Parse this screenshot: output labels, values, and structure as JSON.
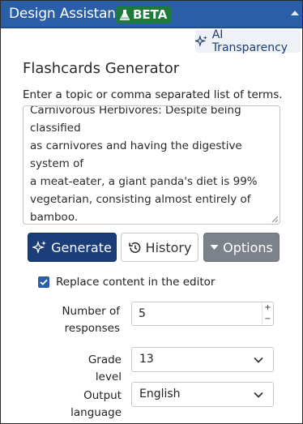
{
  "header": {
    "app_title": "Design Assistant",
    "badge_label": "BETA",
    "badge_icon": "flask-icon"
  },
  "toolbar": {
    "transparency_label": "AI Transparency",
    "transparency_icon": "sparkle-icon"
  },
  "form": {
    "section_title": "Flashcards Generator",
    "instructions": "Enter a topic or comma separated list of terms.",
    "topic_text": "Carnivorous Herbivores: Despite being classified\nas carnivores and having the digestive system of\na meat-eater, a giant panda's diet is 99%\nvegetarian, consisting almost entirely of bamboo.\n\nA Built-in Bamboo Grasp: To help them hold and\nstrip bamboo stalks, pandas have evolved a"
  },
  "actions": {
    "generate_label": "Generate",
    "history_label": "History",
    "options_label": "Options"
  },
  "options": {
    "replace_label": "Replace content in the editor",
    "replace_checked": true,
    "responses_label_line1": "Number of",
    "responses_label_line2": "responses",
    "responses_value": "5",
    "stepper_up": "+",
    "stepper_down": "−",
    "grade_label": "Grade level",
    "grade_value": "13",
    "language_label_line1": "Output",
    "language_label_line2": "language",
    "language_value": "English"
  },
  "colors": {
    "header_bg": "#2a5fa8",
    "badge_bg": "#1e7a3b",
    "generate_bg": "#1b3d78",
    "options_bg": "#7b8289"
  }
}
